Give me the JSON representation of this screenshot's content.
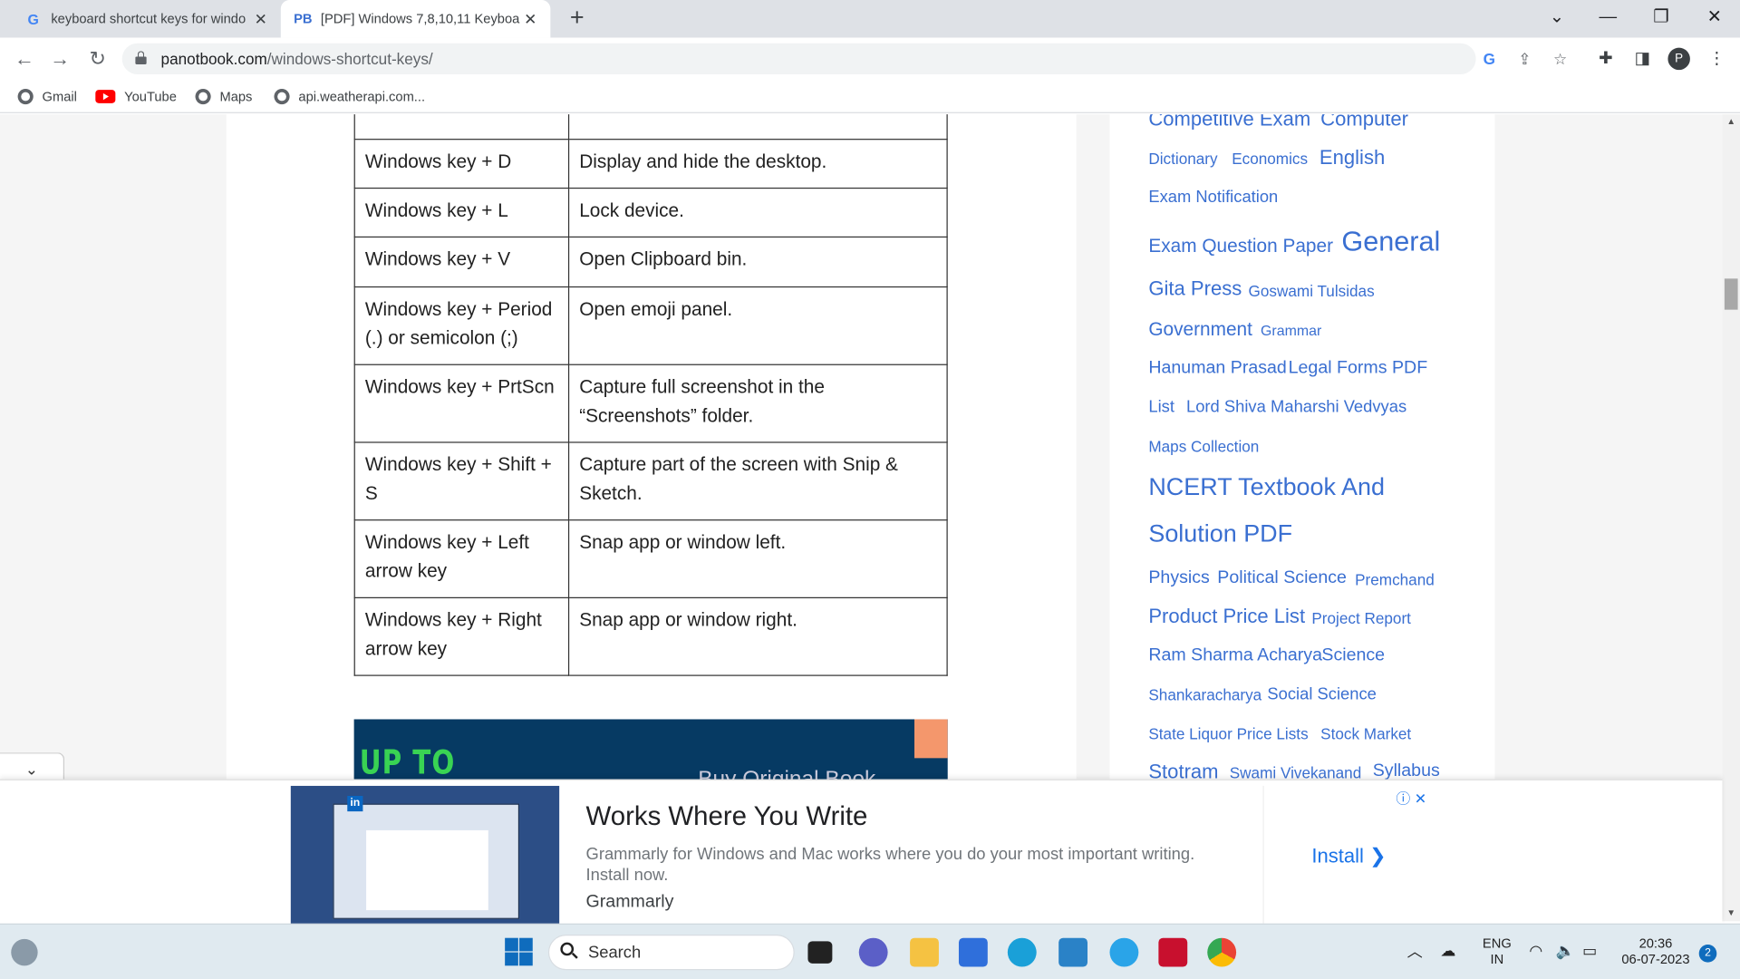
{
  "browser": {
    "tabs": [
      {
        "title": "keyboard shortcut keys for windo",
        "favicon": "G",
        "active": false
      },
      {
        "title": "[PDF] Windows 7,8,10,11 Keyboa",
        "favicon": "PB",
        "active": true
      }
    ],
    "new_tab": "+",
    "window_controls": {
      "dropdown": "⌄",
      "minimize": "—",
      "restore": "❐",
      "close": "✕"
    },
    "url": {
      "host": "panotbook.com",
      "path": "/windows-shortcut-keys/"
    },
    "profile_initial": "P",
    "bookmarks": [
      {
        "label": "Gmail",
        "icon": "globe-icon"
      },
      {
        "label": "YouTube",
        "icon": "youtube-icon"
      },
      {
        "label": "Maps",
        "icon": "globe-icon"
      },
      {
        "label": "api.weatherapi.com...",
        "icon": "globe-icon"
      }
    ]
  },
  "table": {
    "rows": [
      {
        "key": "Windows key + D",
        "action": "Display and hide the desktop."
      },
      {
        "key": "Windows key + L",
        "action": "Lock device."
      },
      {
        "key": "Windows key + V",
        "action": "Open Clipboard bin."
      },
      {
        "key": "Windows key + Period (.) or semicolon (;)",
        "action": "Open emoji panel."
      },
      {
        "key": "Windows key + PrtScn",
        "action": "Capture full screenshot in the “Screenshots” folder."
      },
      {
        "key": "Windows key + Shift + S",
        "action": "Capture part of the screen with Snip & Sketch."
      },
      {
        "key": "Windows key + Left arrow key",
        "action": "Snap app or window left."
      },
      {
        "key": "Windows key + Right arrow key",
        "action": "Snap app or window right."
      }
    ]
  },
  "promo": {
    "headline": "UP TO",
    "sub": "Buy Original Book"
  },
  "tags": [
    "Competitive Exam",
    "Computer",
    "Dictionary",
    "Economics",
    "English",
    "Exam Notification",
    "Exam Question Paper",
    "General",
    "Gita Press",
    "Goswami Tulsidas",
    "Government",
    "Grammar",
    "Hanuman Prasad",
    "Legal Forms PDF",
    "List",
    "Lord Shiva",
    "Maharshi Vedvyas",
    "Maps Collection",
    "NCERT Textbook And",
    "Solution PDF",
    "Physics",
    "Political Science",
    "Premchand",
    "Product Price List",
    "Project Report",
    "Ram Sharma Acharya",
    "Science",
    "Shankaracharya",
    "Social Science",
    "State Liquor Price Lists",
    "Stock Market",
    "Stotram",
    "Swami Vivekanand",
    "Syllabus"
  ],
  "ad": {
    "headline": "Works Where You Write",
    "description": "Grammarly for Windows and Mac works where you do your most important writing. Install now.",
    "brand": "Grammarly",
    "cta": "Install",
    "info_icons": "ⓘ ✕"
  },
  "taskbar": {
    "search_placeholder": "Search",
    "language": "ENG",
    "region": "IN",
    "time": "20:36",
    "date": "06-07-2023",
    "notification_count": "2"
  },
  "colors": {
    "tag_link": "#3a6fd1",
    "ad_link": "#1a73e8",
    "promo_bg": "#063a63",
    "promo_text": "#39d353"
  }
}
